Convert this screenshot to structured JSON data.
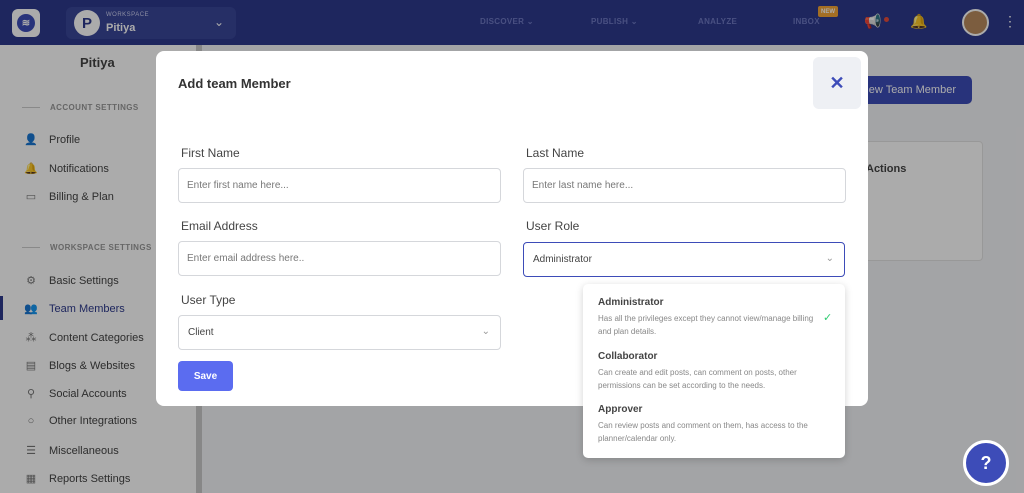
{
  "topbar": {
    "workspace_small": "WORKSPACE",
    "workspace_name": "Pitiya",
    "workspace_initial": "P",
    "nav": [
      "DISCOVER ⌄",
      "PUBLISH ⌄",
      "ANALYZE",
      "INBOX"
    ],
    "new_badge": "NEW"
  },
  "sidebar": {
    "profile_name": "Pitiya",
    "account_title": "ACCOUNT SETTINGS",
    "account_items": [
      "Profile",
      "Notifications",
      "Billing & Plan"
    ],
    "workspace_title": "WORKSPACE SETTINGS",
    "workspace_items": [
      "Basic Settings",
      "Team Members",
      "Content Categories",
      "Blogs & Websites",
      "Social Accounts",
      "Other Integrations",
      "Miscellaneous",
      "Reports Settings"
    ]
  },
  "main": {
    "new_member_button": "New Team Member",
    "actions_header": "Actions"
  },
  "modal": {
    "title": "Add team Member",
    "first_name_label": "First Name",
    "first_name_placeholder": "Enter first name here...",
    "last_name_label": "Last Name",
    "last_name_placeholder": "Enter last name here...",
    "email_label": "Email Address",
    "email_placeholder": "Enter email address here..",
    "role_label": "User Role",
    "role_value": "Administrator",
    "type_label": "User Type",
    "type_value": "Client",
    "save_label": "Save"
  },
  "role_options": [
    {
      "title": "Administrator",
      "desc": "Has all the privileges except they cannot view/manage billing and plan details."
    },
    {
      "title": "Collaborator",
      "desc": "Can create and edit posts, can comment on posts, other permissions can be set according to the needs."
    },
    {
      "title": "Approver",
      "desc": "Can review posts and comment on them, has access to the planner/calendar only."
    }
  ],
  "help_label": "?"
}
